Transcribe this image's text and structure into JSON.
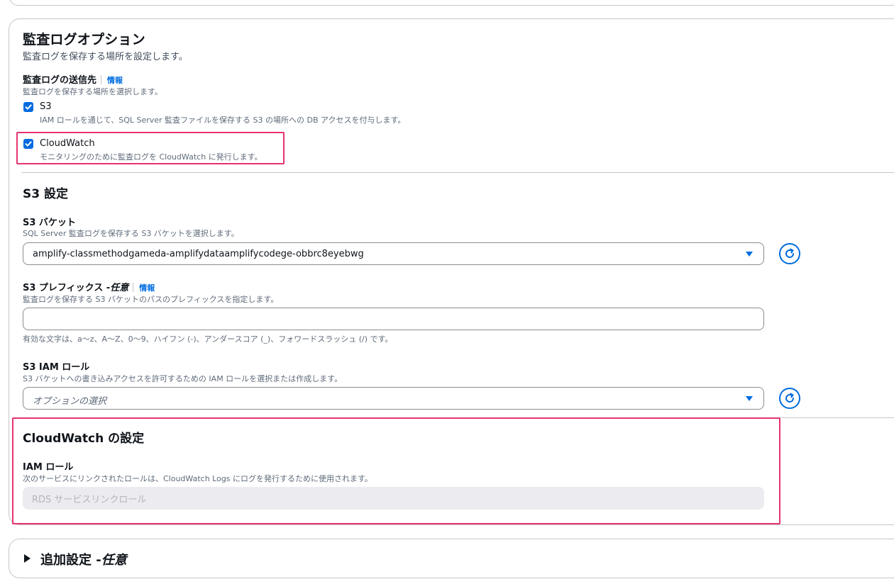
{
  "audit_section": {
    "title": "監査ログオプション",
    "description": "監査ログを保存する場所を設定します。",
    "destination_label": "監査ログの送信先",
    "info_link": "情報",
    "destination_description": "監査ログを保存する場所を選択します。",
    "s3_option": {
      "label": "S3",
      "checked": true,
      "description": "IAM ロールを通じて、SQL Server 監査ファイルを保存する S3 の場所への DB アクセスを付与します。"
    },
    "cloudwatch_option": {
      "label": "CloudWatch",
      "checked": true,
      "description": "モニタリングのために監査ログを CloudWatch に発行します。"
    }
  },
  "s3_settings": {
    "title": "S3 設定",
    "bucket": {
      "label": "S3 バケット",
      "description": "SQL Server 監査ログを保存する S3 バケットを選択します。",
      "value": "amplify-classmethodgameda-amplifydataamplifycodege-obbrc8eyebwg"
    },
    "prefix": {
      "label": "S3 プレフィックス -",
      "label_optional": "任意",
      "info_link": "情報",
      "description": "監査ログを保存する S3 バケットのパスのプレフィックスを指定します。",
      "value": "",
      "hint": "有効な文字は、a〜z、A〜Z、0〜9、ハイフン (-)、アンダースコア (_)、フォワードスラッシュ (/) です。"
    },
    "iam_role": {
      "label": "S3 IAM ロール",
      "description": "S3 バケットへの書き込みアクセスを許可するための IAM ロールを選択または作成します。",
      "placeholder": "オプションの選択"
    }
  },
  "cloudwatch_settings": {
    "title": "CloudWatch の設定",
    "iam_label": "IAM ロール",
    "iam_description": "次のサービスにリンクされたロールは、CloudWatch Logs にログを発行するために使用されます。",
    "iam_value": "RDS サービスリンクロール"
  },
  "additional_settings": {
    "title": "追加設定 -",
    "title_optional": "任意"
  },
  "colors": {
    "accent": "#006ce0",
    "highlight": "#e8336d",
    "border": "#c6c6cd"
  }
}
